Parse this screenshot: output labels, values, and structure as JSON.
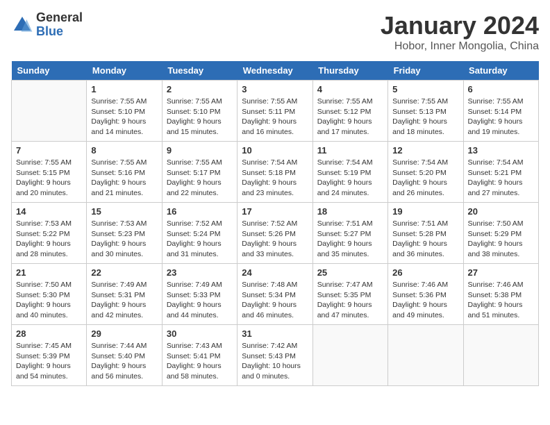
{
  "logo": {
    "general": "General",
    "blue": "Blue"
  },
  "title": "January 2024",
  "subtitle": "Hobor, Inner Mongolia, China",
  "weekdays": [
    "Sunday",
    "Monday",
    "Tuesday",
    "Wednesday",
    "Thursday",
    "Friday",
    "Saturday"
  ],
  "weeks": [
    [
      {
        "day": "",
        "info": ""
      },
      {
        "day": "1",
        "info": "Sunrise: 7:55 AM\nSunset: 5:10 PM\nDaylight: 9 hours\nand 14 minutes."
      },
      {
        "day": "2",
        "info": "Sunrise: 7:55 AM\nSunset: 5:10 PM\nDaylight: 9 hours\nand 15 minutes."
      },
      {
        "day": "3",
        "info": "Sunrise: 7:55 AM\nSunset: 5:11 PM\nDaylight: 9 hours\nand 16 minutes."
      },
      {
        "day": "4",
        "info": "Sunrise: 7:55 AM\nSunset: 5:12 PM\nDaylight: 9 hours\nand 17 minutes."
      },
      {
        "day": "5",
        "info": "Sunrise: 7:55 AM\nSunset: 5:13 PM\nDaylight: 9 hours\nand 18 minutes."
      },
      {
        "day": "6",
        "info": "Sunrise: 7:55 AM\nSunset: 5:14 PM\nDaylight: 9 hours\nand 19 minutes."
      }
    ],
    [
      {
        "day": "7",
        "info": "Sunrise: 7:55 AM\nSunset: 5:15 PM\nDaylight: 9 hours\nand 20 minutes."
      },
      {
        "day": "8",
        "info": "Sunrise: 7:55 AM\nSunset: 5:16 PM\nDaylight: 9 hours\nand 21 minutes."
      },
      {
        "day": "9",
        "info": "Sunrise: 7:55 AM\nSunset: 5:17 PM\nDaylight: 9 hours\nand 22 minutes."
      },
      {
        "day": "10",
        "info": "Sunrise: 7:54 AM\nSunset: 5:18 PM\nDaylight: 9 hours\nand 23 minutes."
      },
      {
        "day": "11",
        "info": "Sunrise: 7:54 AM\nSunset: 5:19 PM\nDaylight: 9 hours\nand 24 minutes."
      },
      {
        "day": "12",
        "info": "Sunrise: 7:54 AM\nSunset: 5:20 PM\nDaylight: 9 hours\nand 26 minutes."
      },
      {
        "day": "13",
        "info": "Sunrise: 7:54 AM\nSunset: 5:21 PM\nDaylight: 9 hours\nand 27 minutes."
      }
    ],
    [
      {
        "day": "14",
        "info": "Sunrise: 7:53 AM\nSunset: 5:22 PM\nDaylight: 9 hours\nand 28 minutes."
      },
      {
        "day": "15",
        "info": "Sunrise: 7:53 AM\nSunset: 5:23 PM\nDaylight: 9 hours\nand 30 minutes."
      },
      {
        "day": "16",
        "info": "Sunrise: 7:52 AM\nSunset: 5:24 PM\nDaylight: 9 hours\nand 31 minutes."
      },
      {
        "day": "17",
        "info": "Sunrise: 7:52 AM\nSunset: 5:26 PM\nDaylight: 9 hours\nand 33 minutes."
      },
      {
        "day": "18",
        "info": "Sunrise: 7:51 AM\nSunset: 5:27 PM\nDaylight: 9 hours\nand 35 minutes."
      },
      {
        "day": "19",
        "info": "Sunrise: 7:51 AM\nSunset: 5:28 PM\nDaylight: 9 hours\nand 36 minutes."
      },
      {
        "day": "20",
        "info": "Sunrise: 7:50 AM\nSunset: 5:29 PM\nDaylight: 9 hours\nand 38 minutes."
      }
    ],
    [
      {
        "day": "21",
        "info": "Sunrise: 7:50 AM\nSunset: 5:30 PM\nDaylight: 9 hours\nand 40 minutes."
      },
      {
        "day": "22",
        "info": "Sunrise: 7:49 AM\nSunset: 5:31 PM\nDaylight: 9 hours\nand 42 minutes."
      },
      {
        "day": "23",
        "info": "Sunrise: 7:49 AM\nSunset: 5:33 PM\nDaylight: 9 hours\nand 44 minutes."
      },
      {
        "day": "24",
        "info": "Sunrise: 7:48 AM\nSunset: 5:34 PM\nDaylight: 9 hours\nand 46 minutes."
      },
      {
        "day": "25",
        "info": "Sunrise: 7:47 AM\nSunset: 5:35 PM\nDaylight: 9 hours\nand 47 minutes."
      },
      {
        "day": "26",
        "info": "Sunrise: 7:46 AM\nSunset: 5:36 PM\nDaylight: 9 hours\nand 49 minutes."
      },
      {
        "day": "27",
        "info": "Sunrise: 7:46 AM\nSunset: 5:38 PM\nDaylight: 9 hours\nand 51 minutes."
      }
    ],
    [
      {
        "day": "28",
        "info": "Sunrise: 7:45 AM\nSunset: 5:39 PM\nDaylight: 9 hours\nand 54 minutes."
      },
      {
        "day": "29",
        "info": "Sunrise: 7:44 AM\nSunset: 5:40 PM\nDaylight: 9 hours\nand 56 minutes."
      },
      {
        "day": "30",
        "info": "Sunrise: 7:43 AM\nSunset: 5:41 PM\nDaylight: 9 hours\nand 58 minutes."
      },
      {
        "day": "31",
        "info": "Sunrise: 7:42 AM\nSunset: 5:43 PM\nDaylight: 10 hours\nand 0 minutes."
      },
      {
        "day": "",
        "info": ""
      },
      {
        "day": "",
        "info": ""
      },
      {
        "day": "",
        "info": ""
      }
    ]
  ]
}
